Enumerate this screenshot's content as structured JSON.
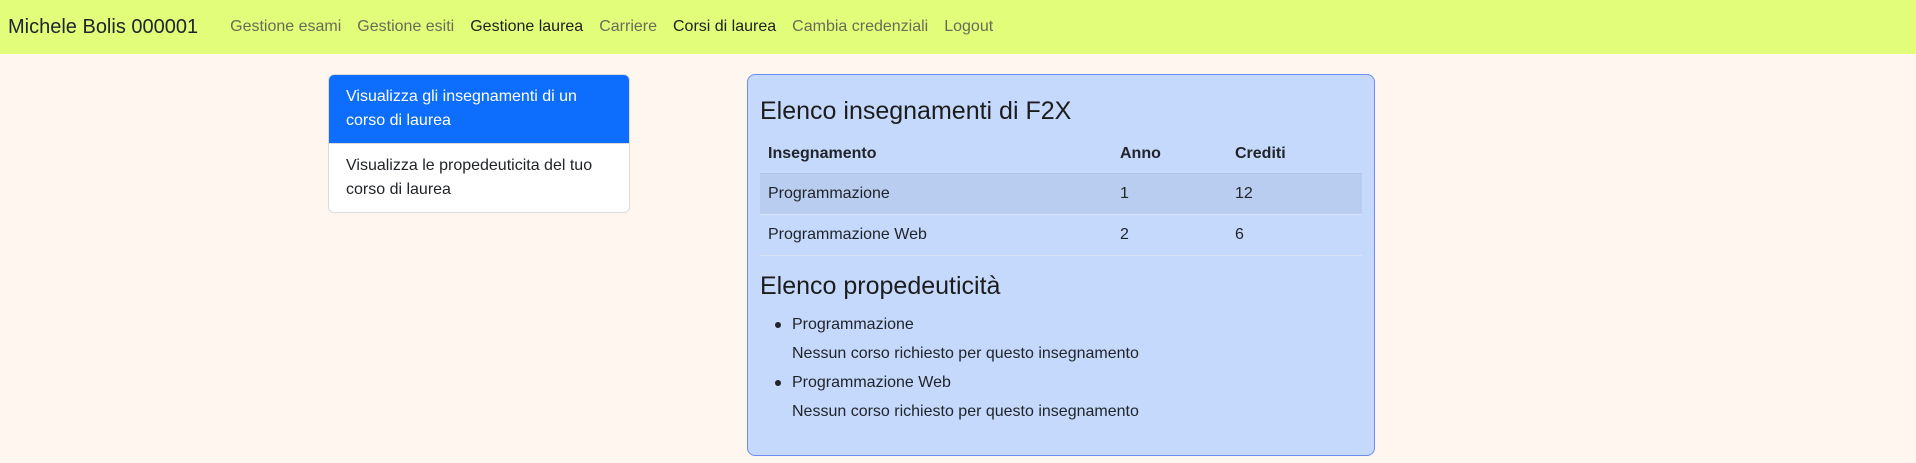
{
  "navbar": {
    "brand": "Michele Bolis 000001",
    "links": [
      {
        "label": "Gestione esami"
      },
      {
        "label": "Gestione esiti"
      },
      {
        "label": "Gestione laurea"
      },
      {
        "label": "Carriere"
      },
      {
        "label": "Corsi di laurea"
      },
      {
        "label": "Cambia credenziali"
      },
      {
        "label": "Logout"
      }
    ],
    "colors": {
      "background": "#e2fd7a",
      "muted": "#6b6b59",
      "active": "#1f1f1f"
    }
  },
  "sidebar": {
    "items": [
      {
        "label": "Visualizza gli insegnamenti di un corso di laurea"
      },
      {
        "label": "Visualizza le propedeuticita del tuo corso di laurea"
      }
    ],
    "active_color": "#0d6efd"
  },
  "courses": {
    "title": "Elenco insegnamenti di F2X",
    "headers": [
      "Insegnamento",
      "Anno",
      "Crediti"
    ],
    "rows": [
      [
        "Programmazione",
        "1",
        "12"
      ],
      [
        "Programmazione Web",
        "2",
        "6"
      ]
    ]
  },
  "prerequisites": {
    "title": "Elenco propedeuticità",
    "items": [
      {
        "name": "Programmazione",
        "note": "Nessun corso richiesto per questo insegnamento"
      },
      {
        "name": "Programmazione Web",
        "note": "Nessun corso richiesto per questo insegnamento"
      }
    ]
  },
  "colors": {
    "page_background": "#fff6f0",
    "card_background": "#c5d9fd",
    "card_border": "#6c8ef2"
  }
}
